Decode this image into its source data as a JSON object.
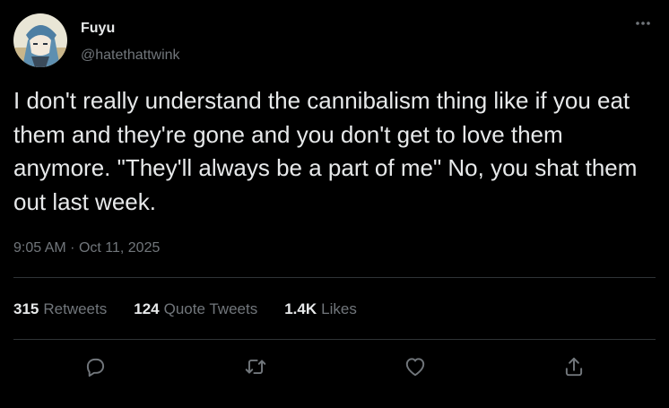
{
  "user": {
    "display_name": "Fuyu",
    "handle": "@hatethattwink",
    "avatar_icon": "anime-character-avatar"
  },
  "tweet": {
    "text": "I don't really understand the cannibalism thing like if you eat them and they're gone and you don't get to love them anymore. \"They'll always be a part of me\" No, you shat them out last week.",
    "time": "9:05 AM",
    "separator": "·",
    "date": "Oct 11, 2025"
  },
  "stats": {
    "retweets_count": "315",
    "retweets_label": "Retweets",
    "quotes_count": "124",
    "quotes_label": "Quote Tweets",
    "likes_count": "1.4K",
    "likes_label": "Likes"
  },
  "actions": {
    "reply_icon": "reply-icon",
    "retweet_icon": "retweet-icon",
    "like_icon": "like-icon",
    "share_icon": "share-icon",
    "more_icon": "more-icon"
  },
  "colors": {
    "background": "#000000",
    "primary_text": "#e7e9ea",
    "secondary_text": "#71767b",
    "divider": "#2f3336"
  }
}
